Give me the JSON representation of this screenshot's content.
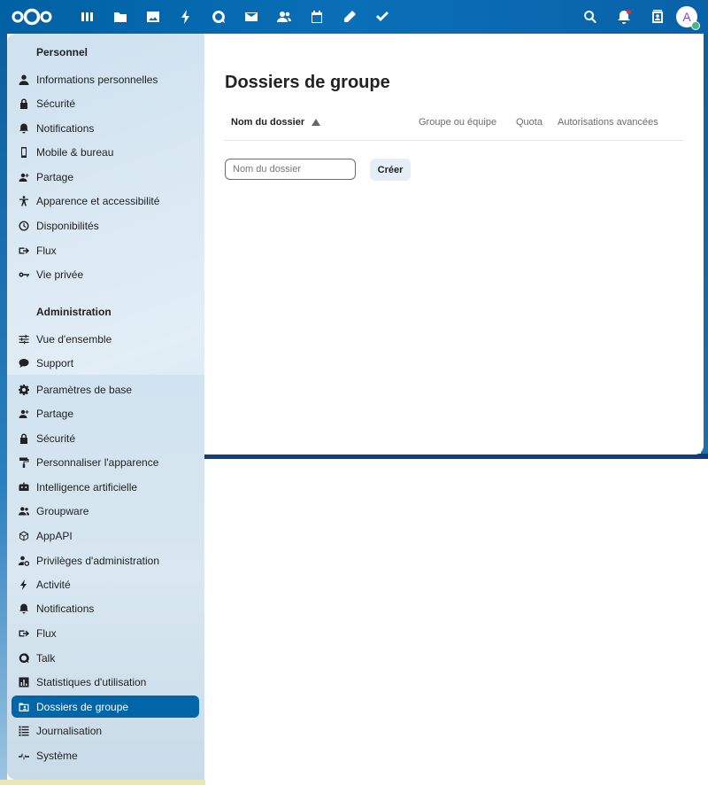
{
  "topbar": {
    "logo_icon": "nextcloud-logo-icon",
    "apps": [
      {
        "name": "dashboard-icon"
      },
      {
        "name": "files-icon"
      },
      {
        "name": "photos-icon"
      },
      {
        "name": "activity-icon"
      },
      {
        "name": "talk-icon"
      },
      {
        "name": "mail-icon"
      },
      {
        "name": "contacts-icon"
      },
      {
        "name": "calendar-icon"
      },
      {
        "name": "notes-icon"
      },
      {
        "name": "tasks-icon"
      }
    ],
    "right": [
      "search-icon",
      "notifications-icon",
      "contacts-menu-icon"
    ],
    "avatar_letter": "A"
  },
  "sidebar": {
    "personal_title": "Personnel",
    "personal_items": [
      {
        "label": "Informations personnelles",
        "icon": "user-icon"
      },
      {
        "label": "Sécurité",
        "icon": "lock-icon"
      },
      {
        "label": "Notifications",
        "icon": "bell-icon"
      },
      {
        "label": "Mobile & bureau",
        "icon": "phone-icon"
      },
      {
        "label": "Partage",
        "icon": "share-user-icon"
      },
      {
        "label": "Apparence et accessibilité",
        "icon": "accessibility-icon"
      },
      {
        "label": "Disponibilités",
        "icon": "clock-icon"
      },
      {
        "label": "Flux",
        "icon": "flow-icon"
      },
      {
        "label": "Vie privée",
        "icon": "key-icon"
      }
    ],
    "admin_title": "Administration",
    "admin_items": [
      {
        "label": "Vue d'ensemble",
        "icon": "tune-icon"
      },
      {
        "label": "Support",
        "icon": "chat-bubble-icon"
      },
      {
        "label": "Paramètres de base",
        "icon": "gear-icon"
      },
      {
        "label": "Partage",
        "icon": "share-user-icon"
      },
      {
        "label": "Sécurité",
        "icon": "lock-icon"
      },
      {
        "label": "Personnaliser l'apparence",
        "icon": "paint-roller-icon"
      },
      {
        "label": "Intelligence artificielle",
        "icon": "robot-icon"
      },
      {
        "label": "Groupware",
        "icon": "group-icon"
      },
      {
        "label": "AppAPI",
        "icon": "cube-icon"
      },
      {
        "label": "Privilèges d'administration",
        "icon": "user-cog-icon"
      },
      {
        "label": "Activité",
        "icon": "lightning-icon"
      },
      {
        "label": "Notifications",
        "icon": "bell-icon"
      },
      {
        "label": "Flux",
        "icon": "flow-icon"
      },
      {
        "label": "Talk",
        "icon": "talk-icon"
      },
      {
        "label": "Statistiques d'utilisation",
        "icon": "chart-icon"
      },
      {
        "label": "Dossiers de groupe",
        "icon": "folder-account-icon",
        "active": true
      },
      {
        "label": "Journalisation",
        "icon": "list-icon"
      },
      {
        "label": "Système",
        "icon": "pulse-icon"
      }
    ]
  },
  "main": {
    "title": "Dossiers de groupe",
    "columns": [
      "Nom du dossier",
      "Groupe ou équipe",
      "Quota",
      "Autorisations avancées"
    ],
    "input_placeholder": "Nom du dossier",
    "input_value": "",
    "create_label": "Créer"
  },
  "colors": {
    "header": "#0a6fb7",
    "active_item": "#0066a8",
    "sidebar_bg": "#d8e7f1"
  }
}
